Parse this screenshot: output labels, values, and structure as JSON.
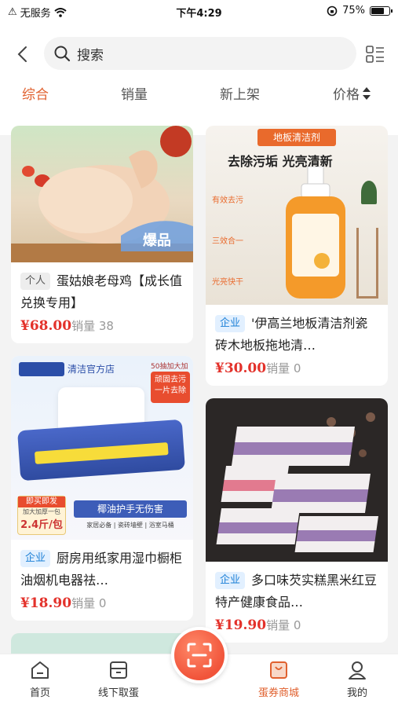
{
  "status_bar": {
    "carrier": "无服务",
    "time": "下午4:29",
    "battery": "75%",
    "battery_level": 0.75
  },
  "header": {
    "search_placeholder": "搜索"
  },
  "tabs": [
    {
      "label": "综合"
    },
    {
      "label": "销量"
    },
    {
      "label": "新上架"
    },
    {
      "label": "价格"
    }
  ],
  "products": [
    {
      "badge": "个人",
      "name": "蛋姑娘老母鸡【成长值兑换专用】",
      "price": "¥68.00",
      "sales": "销量 38",
      "image_tag": "爆品"
    },
    {
      "badge": "企业",
      "name": "'伊高兰地板清洁剂瓷砖木地板拖地清…",
      "price": "¥30.00",
      "sales": "销量 0",
      "image_top": "地板清洁剂",
      "image_headline": "去除污垢  光亮清新",
      "image_points": [
        "有效去污",
        "三效合一",
        "光亮快干"
      ]
    },
    {
      "badge": "企业",
      "name": "厨房用纸家用湿巾橱柜油烟机电器祛…",
      "price": "¥18.90",
      "sales": "销量 0",
      "image_brand": "清洁官方店",
      "image_corner": "50抽加大加厚",
      "image_corner2": "顽固去污 一片去除",
      "image_promo": "椰油护手无伤害",
      "image_promo2": "家居必备 | 瓷砖墙壁 | 浴室马桶",
      "image_ship": "即买即发",
      "image_size": "加大加厚一包",
      "image_weight": "2.4斤/包"
    },
    {
      "badge": "企业",
      "name": "多口味芡实糕黑米红豆特产健康食品…",
      "price": "¥19.90",
      "sales": "销量 0"
    }
  ],
  "nav": [
    {
      "label": "首页",
      "icon": "home-icon"
    },
    {
      "label": "线下取蛋",
      "icon": "box-icon"
    },
    {
      "label": "蛋券商城",
      "icon": "shop-bag-icon"
    },
    {
      "label": "我的",
      "icon": "user-icon"
    }
  ],
  "colors": {
    "accent": "#e0602e",
    "price": "#e3322b",
    "biz_badge_bg": "#e2f0ff",
    "biz_badge_text": "#1a7fd6"
  }
}
